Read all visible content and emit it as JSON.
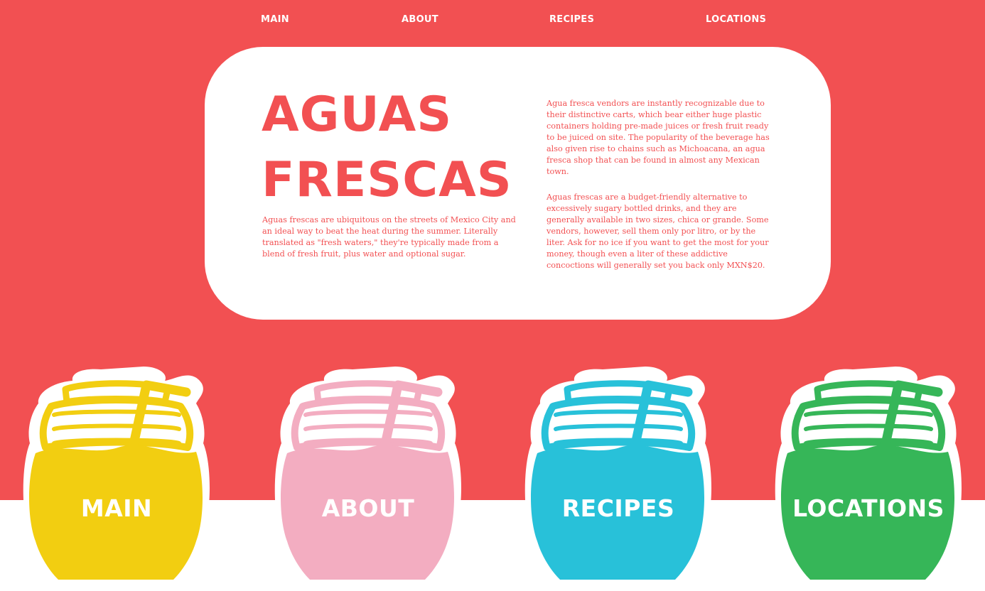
{
  "colors": {
    "brand_red": "#f25052",
    "yellow": "#f2ce11",
    "pink": "#f3adc1",
    "blue": "#28c1d9",
    "green": "#36b658"
  },
  "nav": {
    "main": "MAIN",
    "about": "ABOUT",
    "recipes": "RECIPES",
    "locations": "LOCATIONS"
  },
  "hero": {
    "title_line1": "AGUAS",
    "title_line2": "FRESCAS",
    "intro": "Aguas frescas are ubiquitous on the streets of Mexico City and an ideal way to beat the heat during the summer. Literally translated as \"fresh waters,\" they're typically made from a blend of fresh fruit, plus water and optional sugar.",
    "paragraph_1": "Agua fresca vendors are instantly recognizable due to their distinctive carts, which bear either huge plastic containers holding pre-made juices or fresh fruit ready to be juiced on site. The popularity of the beverage has also given rise to chains such as Michoacana, an agua fresca shop that can be found in almost any Mexican town.",
    "paragraph_2": "Aguas frescas are a budget-friendly alternative to excessively sugary bottled drinks, and they are generally available in two sizes, chica or grande. Some vendors, however, sell them only por litro, or by the liter. Ask for no ice if you want to get the most for your money, though even a liter of these addictive concoctions will generally set you back only MXN$20."
  },
  "jars": [
    {
      "label": "MAIN",
      "color": "#f2ce11",
      "icon": "yellow-jar-icon"
    },
    {
      "label": "ABOUT",
      "color": "#f3adc1",
      "icon": "pink-jar-icon"
    },
    {
      "label": "RECIPES",
      "color": "#28c1d9",
      "icon": "blue-jar-icon"
    },
    {
      "label": "LOCATIONS",
      "color": "#36b658",
      "icon": "green-jar-icon"
    }
  ]
}
